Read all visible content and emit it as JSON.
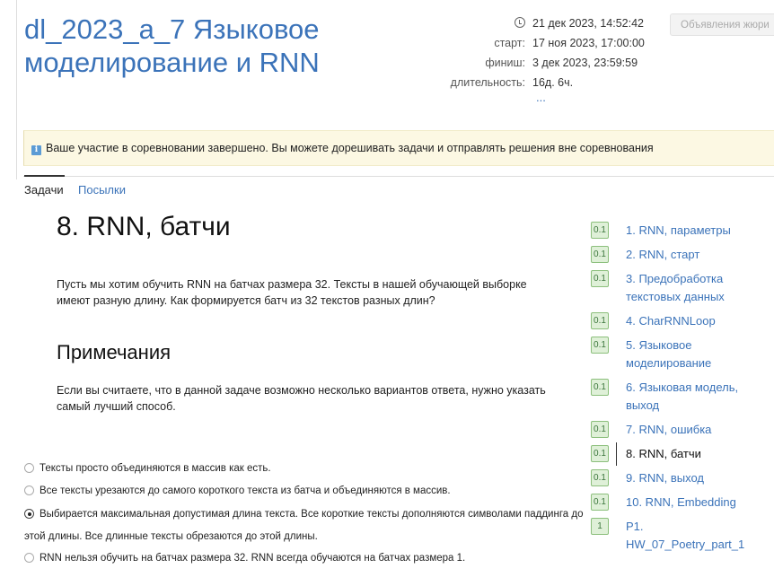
{
  "header": {
    "title": "dl_2023_a_7 Языковое моделирование и RNN",
    "current_time": "21 дек 2023, 14:52:42",
    "start_label": "старт:",
    "start_value": "17 ноя 2023, 17:00:00",
    "finish_label": "финиш:",
    "finish_value": "3 дек 2023, 23:59:59",
    "duration_label": "длительность:",
    "duration_value": "16д. 6ч.",
    "more": "...",
    "jury_button": "Объявления жюри"
  },
  "alert": {
    "icon": "info-icon",
    "text": "Ваше участие в соревновании завершено. Вы можете дорешивать задачи и отправлять решения вне соревнования"
  },
  "tabs": {
    "problems": "Задачи",
    "submissions": "Посылки"
  },
  "problem": {
    "title": "8. RNN, батчи",
    "statement": "Пусть мы хотим обучить RNN на батчах размера 32. Тексты в нашей обучающей выборке имеют разную длину. Как формируется батч из 32 текстов разных длин?",
    "notes_title": "Примечания",
    "notes": "Если вы считаете, что в данной задаче возможно несколько вариантов ответа, нужно указать самый лучший способ.",
    "options": [
      {
        "text": "Тексты просто объединяются в массив как есть.",
        "checked": false
      },
      {
        "text": "Все тексты урезаются до самого короткого текста из батча и объединяются в массив.",
        "checked": false
      },
      {
        "text": "Выбирается максимальная допустимая длина текста. Все короткие тексты дополняются символами паддинга до этой длины. Все длинные тексты обрезаются до этой длины.",
        "checked": true
      },
      {
        "text": "RNN нельзя обучить на батчах размера 32. RNN всегда обучаются на батчах размера 1.",
        "checked": false
      }
    ]
  },
  "sidebar": {
    "items": [
      {
        "score": "0.1",
        "label": "1. RNN, параметры"
      },
      {
        "score": "0.1",
        "label": "2. RNN, старт"
      },
      {
        "score": "0.1",
        "label": "3. Предобработка текстовых данных"
      },
      {
        "score": "0.1",
        "label": "4. CharRNNLoop"
      },
      {
        "score": "0.1",
        "label": "5. Языковое моделирование"
      },
      {
        "score": "0.1",
        "label": "6. Языковая модель, выход"
      },
      {
        "score": "0.1",
        "label": "7. RNN, ошибка"
      },
      {
        "score": "0.1",
        "label": "8. RNN, батчи",
        "current": true
      },
      {
        "score": "0.1",
        "label": "9. RNN, выход"
      },
      {
        "score": "0.1",
        "label": "10. RNN, Embedding"
      },
      {
        "score": "1",
        "label": "P1. HW_07_Poetry_part_1"
      }
    ]
  }
}
